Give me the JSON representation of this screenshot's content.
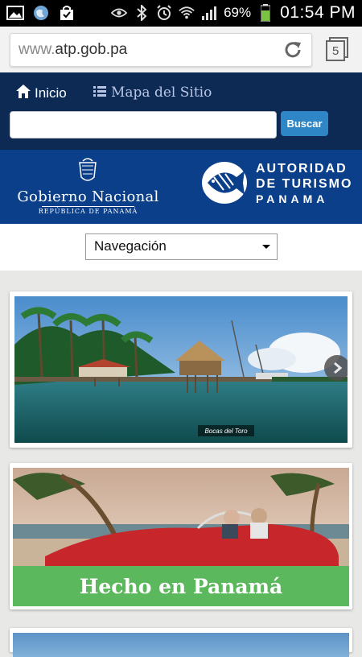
{
  "status_bar": {
    "battery_percent": "69%",
    "time": "01:54 PM",
    "icons_left": [
      "gallery-icon",
      "globe-icon",
      "shopping-bag-icon"
    ],
    "icons_right": [
      "eye-icon",
      "bluetooth-icon",
      "alarm-icon",
      "wifi-icon",
      "signal-icon",
      "battery-icon"
    ]
  },
  "browser": {
    "url_scheme": "www.",
    "url_host": "atp.gob.pa",
    "tab_count": "5"
  },
  "site_nav": {
    "home_label": "Inicio",
    "sitemap_label": "Mapa del Sitio",
    "search_placeholder": "",
    "search_button": "Buscar"
  },
  "banner": {
    "gov_title": "Gobierno Nacional",
    "gov_subtitle": "REPÚBLICA DE PANAMÁ",
    "atp_line1": "AUTORIDAD",
    "atp_line2": "DE TURISMO",
    "atp_line3": "PANAMA"
  },
  "navigation_select": {
    "selected": "Navegación"
  },
  "slides": {
    "slide1_caption": "Bocas del Toro",
    "slide2_title": "Hecho en Panamá"
  },
  "colors": {
    "navbar": "#0d2a55",
    "banner": "#0b3f8a",
    "search_button": "#2f86c6",
    "promo_band": "#5cb85c"
  }
}
